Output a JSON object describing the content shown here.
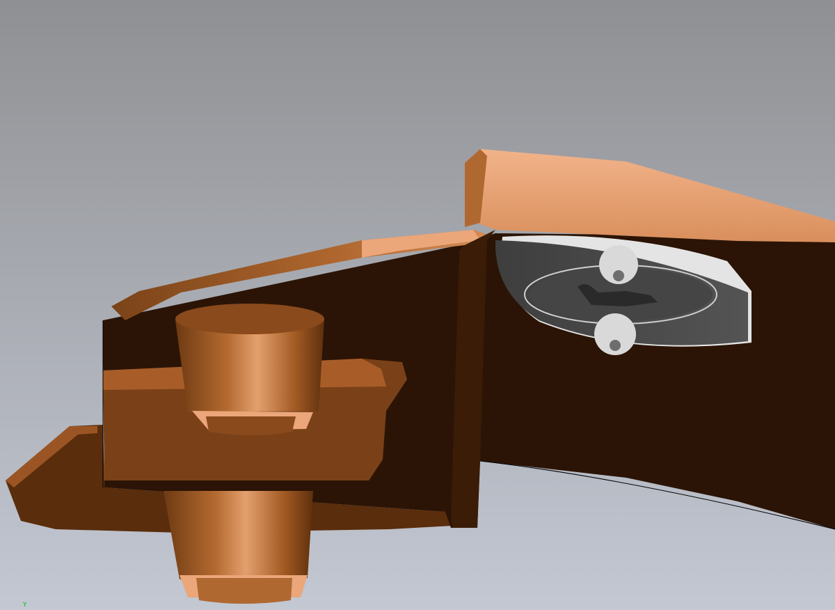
{
  "viewport": {
    "background_top": "#8f9093",
    "background_bottom": "#c3c8d3"
  },
  "materials": {
    "copper_light": "#eba67a",
    "copper_mid": "#b56a31",
    "copper_dark": "#6e3a12",
    "copper_shadow": "#2b1405",
    "steel_dark": "#4b4b4b",
    "steel_light": "#e9e9e9"
  },
  "triad": {
    "axis_label": "Y",
    "color": "#00c000"
  }
}
